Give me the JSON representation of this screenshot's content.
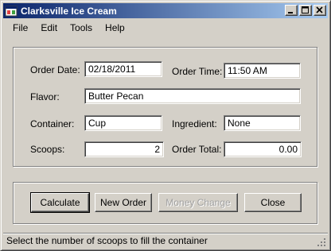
{
  "window": {
    "title": "Clarksville Ice Cream"
  },
  "menu": {
    "file": "File",
    "edit": "Edit",
    "tools": "Tools",
    "help": "Help"
  },
  "form": {
    "order_date_label": "Order Date:",
    "order_date_value": "02/18/2011",
    "order_time_label": "Order Time:",
    "order_time_value": "11:50 AM",
    "flavor_label": "Flavor:",
    "flavor_value": "Butter Pecan",
    "container_label": "Container:",
    "container_value": "Cup",
    "ingredient_label": "Ingredient:",
    "ingredient_value": "None",
    "scoops_label": "Scoops:",
    "scoops_value": "2",
    "order_total_label": "Order Total:",
    "order_total_value": "0.00"
  },
  "buttons": {
    "calculate": "Calculate",
    "new_order": "New Order",
    "money_change": "Money Change",
    "close": "Close"
  },
  "status": {
    "text": "Select the number of scoops to fill the container"
  },
  "colors": {
    "titlebar_start": "#0a246a",
    "titlebar_end": "#a6caf0",
    "face": "#d4d0c8"
  },
  "icons": {
    "app": "app-window-icon",
    "minimize": "minimize-icon",
    "maximize": "maximize-icon",
    "close": "close-icon"
  }
}
